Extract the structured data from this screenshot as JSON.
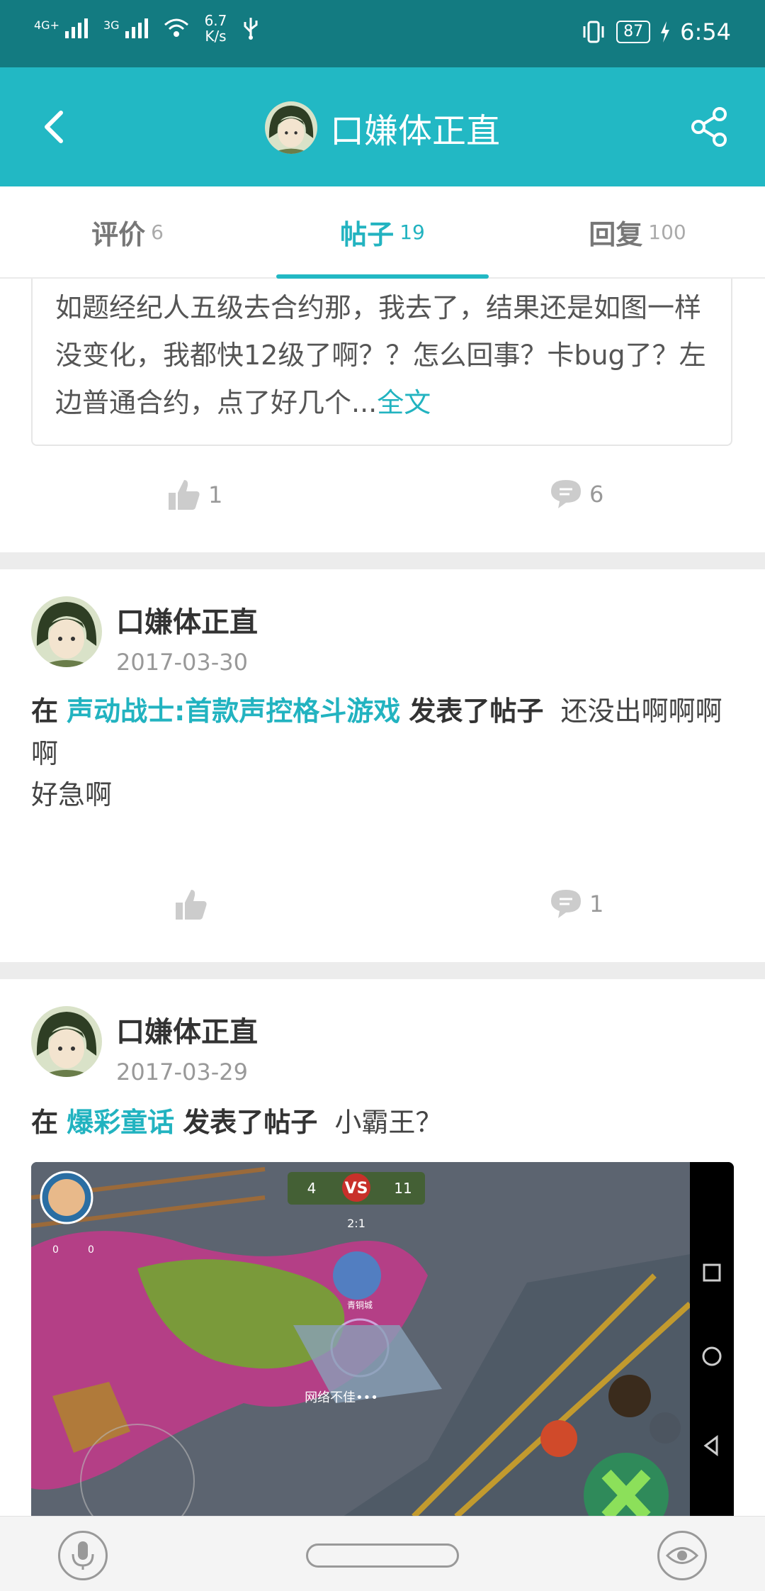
{
  "status_bar": {
    "network_1": "4G+",
    "network_2": "3G",
    "speed_value": "6.7",
    "speed_unit": "K/s",
    "battery": "87",
    "time": "6:54"
  },
  "header": {
    "title": "口嫌体正直"
  },
  "tabs": [
    {
      "label": "评价",
      "count": "6"
    },
    {
      "label": "帖子",
      "count": "19"
    },
    {
      "label": "回复",
      "count": "100"
    }
  ],
  "post0": {
    "body": "如题经纪人五级去合约那，我去了，结果还是如图一样没变化，我都快12级了啊？？怎么回事？卡bug了？左边普通合约，点了好几个...",
    "more": "全文",
    "likes": "1",
    "comments": "6"
  },
  "post1": {
    "user": "口嫌体正直",
    "date": "2017-03-30",
    "prefix": "在",
    "game": "声动战士:首款声控格斗游戏",
    "action": "发表了帖子",
    "title": "还没出啊啊啊啊",
    "body": "好急啊",
    "comments": "1"
  },
  "post2": {
    "user": "口嫌体正直",
    "date": "2017-03-29",
    "prefix": "在",
    "game": "爆彩童话",
    "action": "发表了帖子",
    "title": "小霸王？",
    "screenshot": {
      "score_left": "4",
      "vs": "VS",
      "score_right": "11",
      "timer": "2:1",
      "network_text": "网络不佳•••",
      "player_name": "青铜城",
      "kills": "0",
      "deaths": "0"
    }
  },
  "colors": {
    "accent": "#22b8c4",
    "status_bar": "#137b81"
  }
}
